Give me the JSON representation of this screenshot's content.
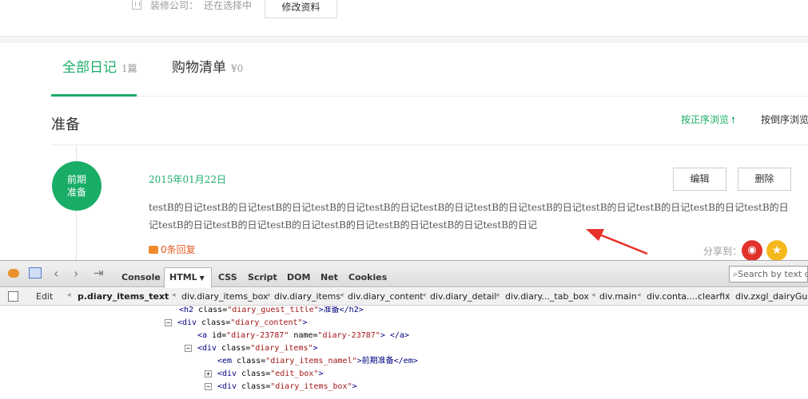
{
  "header": {
    "company_label": "装修公司：",
    "company_value": "还在选择中",
    "edit_profile": "修改资料"
  },
  "tabs": [
    {
      "label": "全部日记",
      "count": "1篇"
    },
    {
      "label": "购物清单",
      "count": "¥0"
    }
  ],
  "diary": {
    "title": "准备",
    "sort_asc": "按正序浏览",
    "sort_desc": "按倒序浏览",
    "stage_line1": "前期",
    "stage_line2": "准备",
    "date": "2015年01月22日",
    "edit": "编辑",
    "delete": "删除",
    "text": "testB的日记testB的日记testB的日记testB的日记testB的日记testB的日记testB的日记testB的日记testB的日记testB的日记testB的日记testB的日记testB的日记testB的日记testB的日记testB的日记testB的日记testB的日记testB的日记",
    "comments": "0条回复",
    "share_label": "分享到：",
    "colors": {
      "accent": "#19ad67",
      "comment": "#e15d25",
      "weibo": "#e0322b",
      "qzone": "#f5b81c"
    }
  },
  "firebug": {
    "tabs": [
      "Console",
      "HTML",
      "CSS",
      "Script",
      "DOM",
      "Net",
      "Cookies"
    ],
    "active_tab": "HTML",
    "search_placeholder": "Search by text c",
    "edit": "Edit",
    "breadcrumbs": [
      "p.diary_items_text",
      "div.diary_items_box",
      "div.diary_items",
      "div.diary_content",
      "div.diary_detail",
      "div.diary..._tab_box",
      "div.main",
      "div.conta....clearfix",
      "div.zxgl_dairyGuest"
    ],
    "tree": [
      {
        "tag_open": "<h2 ",
        "attr": "class=",
        "val": "\"diary_guest_title\"",
        "rest": ">准备</h2>"
      },
      {
        "tag_open": "<div ",
        "attr": "class=",
        "val": "\"diary_content\"",
        "rest": ">"
      },
      {
        "tag_open": "<a ",
        "attr": "id=",
        "val": "\"diary-23787\"",
        "attr2": " name=",
        "val2": "\"diary-23787\"",
        "rest": "> </a>"
      },
      {
        "tag_open": "<div ",
        "attr": "class=",
        "val": "\"diary_items\"",
        "rest": ">"
      },
      {
        "tag_open": "<em ",
        "attr": "class=",
        "val": "\"diary_items_namel\"",
        "rest": ">前期准备</em>"
      },
      {
        "tag_open": "<div ",
        "attr": "class=",
        "val": "\"edit_box\"",
        "rest": ">"
      },
      {
        "tag_open": "<div ",
        "attr": "class=",
        "val": "\"diary_items_box\"",
        "rest": ">"
      }
    ]
  }
}
